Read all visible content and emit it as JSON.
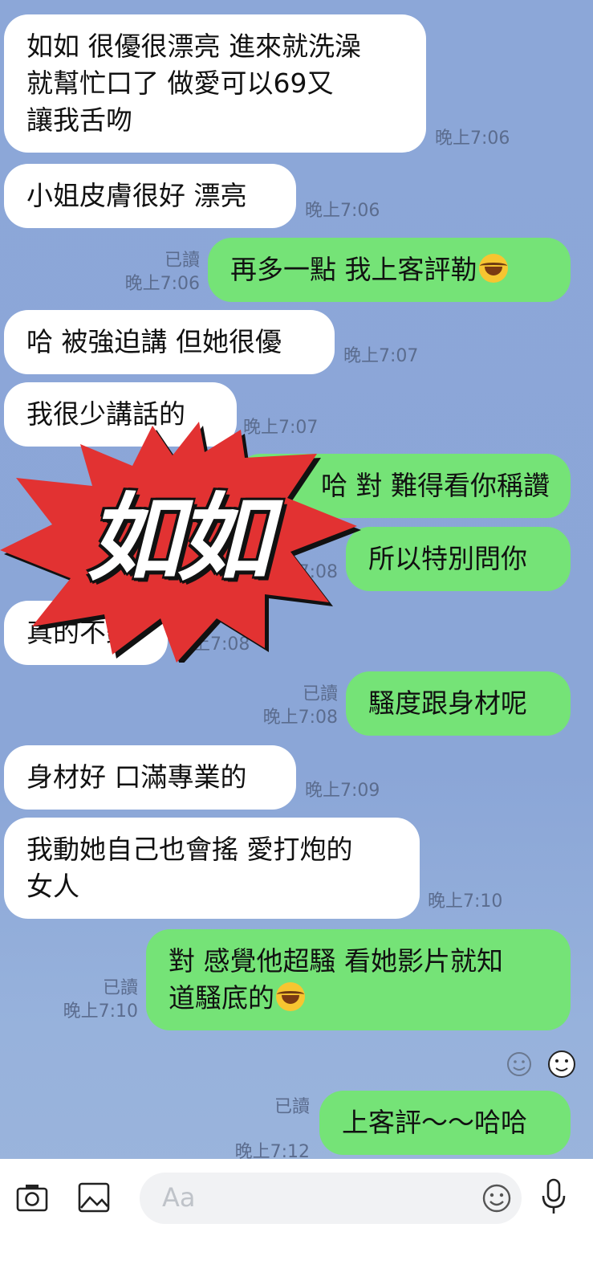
{
  "messages": [
    {
      "side": "in",
      "lines": [
        "如如 很優很漂亮 進來就洗澡",
        "就幫忙口了 做愛可以69又",
        "讓我舌吻"
      ],
      "time": "晚上7:06"
    },
    {
      "side": "in",
      "lines": [
        "小姐皮膚很好 漂亮"
      ],
      "time": "晚上7:06"
    },
    {
      "side": "out",
      "lines": [
        "再多一點 我上客評勒"
      ],
      "read": "已讀",
      "time": "晚上7:06"
    },
    {
      "side": "in",
      "lines": [
        "哈 被強迫講 但她很優"
      ],
      "time": "晚上7:07"
    },
    {
      "side": "in",
      "lines": [
        "我很少講話的"
      ],
      "time": "晚上7:07"
    },
    {
      "side": "out",
      "lines": [
        "哈 對 難得看你稱讚"
      ]
    },
    {
      "side": "out",
      "lines": [
        "所以特別問你"
      ],
      "time": "晚上7:08"
    },
    {
      "side": "in",
      "lines": [
        "真的不錯"
      ],
      "time": "晚上7:08"
    },
    {
      "side": "out",
      "lines": [
        "騷度跟身材呢"
      ],
      "read": "已讀",
      "time": "晚上7:08"
    },
    {
      "side": "in",
      "lines": [
        "身材好 口滿專業的"
      ],
      "time": "晚上7:09"
    },
    {
      "side": "in",
      "lines": [
        "我動她自己也會搖 愛打炮的",
        "女人"
      ],
      "time": "晚上7:10"
    },
    {
      "side": "out",
      "lines": [
        "對 感覺他超騷 看她影片就知",
        "道騷底的"
      ],
      "read": "已讀",
      "time": "晚上7:10"
    },
    {
      "side": "out",
      "lines": [
        "上客評～～哈哈"
      ],
      "read": "已讀",
      "time": "晚上7:12"
    }
  ],
  "sticker_overlay": {
    "text": "如如",
    "color": "#e23232"
  },
  "composer": {
    "placeholder": "Aa"
  },
  "icons": [
    "camera-icon",
    "image-icon",
    "smiley-icon",
    "mic-icon",
    "reaction-smiley-icon",
    "sticker-face-icon",
    "laughing-emoji-icon"
  ],
  "colors": {
    "background": "#8ca7d8",
    "incoming_bubble": "#ffffff",
    "outgoing_bubble": "#75e377",
    "timestamp": "#5b6c8e"
  }
}
